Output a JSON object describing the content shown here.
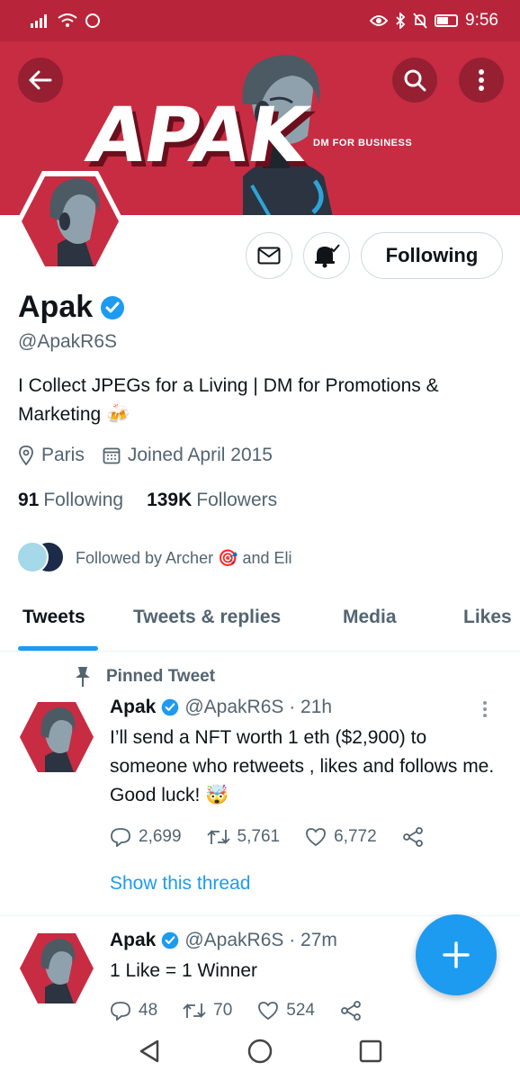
{
  "status_bar": {
    "time": "9:56"
  },
  "banner": {
    "title": "APAK",
    "subtitle": "DM FOR BUSINESS"
  },
  "profile": {
    "name": "Apak",
    "handle": "@ApakR6S",
    "bio": "I Collect JPEGs for a Living | DM for Promotions & Marketing 🍻",
    "location": "Paris",
    "joined": "Joined April 2015",
    "following_count": "91",
    "following_label": "Following",
    "followers_count": "139K",
    "followers_label": "Followers",
    "followed_by": "Followed by Archer 🎯 and Eli",
    "follow_button": "Following"
  },
  "tabs": [
    {
      "label": "Tweets",
      "active": true
    },
    {
      "label": "Tweets & replies",
      "active": false
    },
    {
      "label": "Media",
      "active": false
    },
    {
      "label": "Likes",
      "active": false
    }
  ],
  "tweets": [
    {
      "pinned_label": "Pinned Tweet",
      "name": "Apak",
      "meta": "@ApakR6S · 21h",
      "text": "I’ll send a NFT worth 1 eth ($2,900) to someone who retweets , likes and follows me. Good luck! 🤯",
      "replies": "2,699",
      "retweets": "5,761",
      "likes": "6,772",
      "show_thread": "Show this thread"
    },
    {
      "name": "Apak",
      "meta": "@ApakR6S · 27m",
      "text": "1 Like = 1 Winner",
      "replies": "48",
      "retweets": "70",
      "likes": "524"
    }
  ],
  "colors": {
    "banner": "#c72c43",
    "status_bar": "#b8253a",
    "accent": "#1d9bf0",
    "verified": "#1d9bf0"
  },
  "icons": [
    "back-arrow-icon",
    "search-icon",
    "more-vertical-icon",
    "mail-icon",
    "bell-icon",
    "location-icon",
    "calendar-icon",
    "pin-icon",
    "reply-icon",
    "retweet-icon",
    "like-icon",
    "share-icon",
    "compose-plus-icon"
  ]
}
